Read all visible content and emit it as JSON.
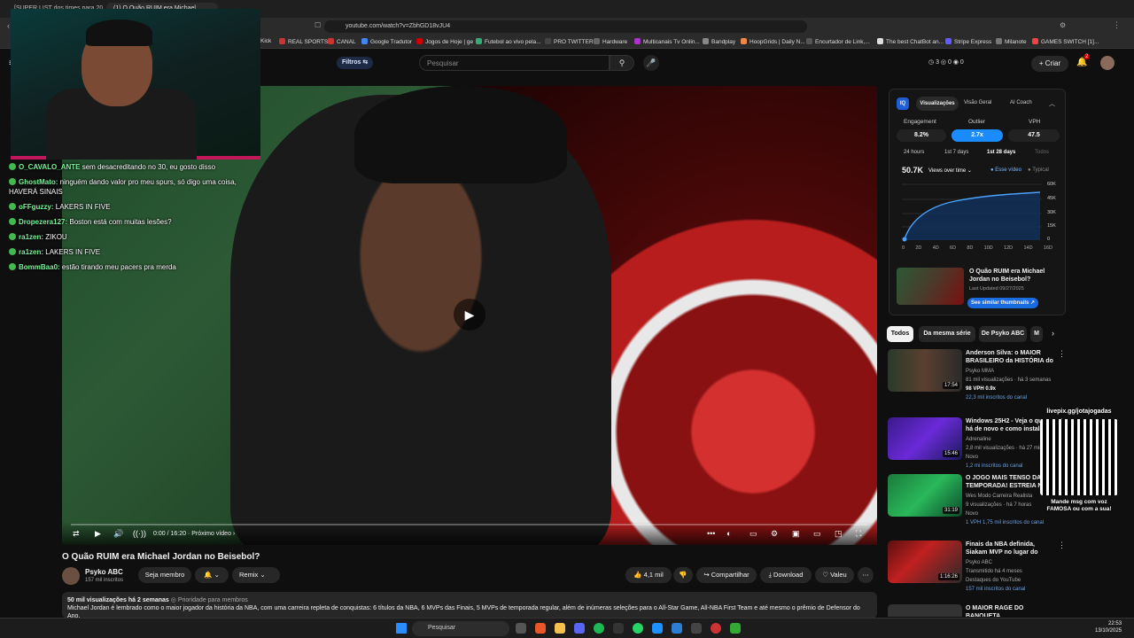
{
  "browser": {
    "tabs": [
      {
        "label": "[SUPER LIST dos times para 2026]",
        "active": false
      },
      {
        "label": "(1) O Quão RUIM era Michael",
        "active": true
      }
    ],
    "url": "youtube.com/watch?v=ZbhGD18vJU4",
    "bookmarks": [
      "Kick",
      "REAL SPORTS",
      "CANAL",
      "Google Tradutor",
      "Jogos de Hoje | ge",
      "Futebol ao vivo pela...",
      "PRO TWITTER",
      "Hardware",
      "Multicanais Tv Onlin...",
      "Bandplay",
      "HoopGrids | Daily N...",
      "Encurtador de Link,...",
      "The best ChatBot an...",
      "Stripe Express",
      "Milanote",
      "GAMES SWITCH [1]..."
    ]
  },
  "header": {
    "filters_label": "Filtros",
    "search_placeholder": "Pesquisar",
    "create_label": "Criar",
    "counters": [
      "3",
      "0",
      "0"
    ],
    "notifications": "2"
  },
  "stream": {
    "chat": [
      {
        "user": "O_CAVALO_ANTE",
        "text": "sem desacreditando no 30, eu gosto disso"
      },
      {
        "user": "GhostMato:",
        "text": "ninguém dando valor pro meu spurs, só digo uma coisa, HAVERÁ SINAIS"
      },
      {
        "user": "oFFguzzy:",
        "text": "LAKERS IN FIVE"
      },
      {
        "user": "Dropezera127:",
        "text": "Boston está com muitas lesões?"
      },
      {
        "user": "ra1zen:",
        "text": "ZIKOU"
      },
      {
        "user": "ra1zen:",
        "text": "LAKERS IN FIVE"
      },
      {
        "user": "BommBaa0:",
        "text": "estão tirando meu pacers pra merda"
      }
    ]
  },
  "player": {
    "time": "0:00 / 16:20",
    "next_label": "Próximo vídeo"
  },
  "video": {
    "title": "O Quão RUIM era Michael Jordan no Beisebol?",
    "channel": "Psyko ABC",
    "subscribers": "157 mil inscritos",
    "join_label": "Seja membro",
    "remix_label": "Remix",
    "likes": "4,1 mil",
    "share_label": "Compartilhar",
    "download_label": "Download",
    "thanks_label": "Valeu",
    "views_date": "50 mil visualizações  há 2 semanas",
    "priority": "Prioridade para membros",
    "description": "Michael Jordan é lembrado como o maior jogador da história da NBA, com uma carreira repleta de conquistas: 6 títulos da NBA, 6 MVPs das Finais, 5 MVPs de temporada regular, além de inúmeras seleções para o All-Star Game, All-NBA First Team e até mesmo o prêmio de Defensor do Ano."
  },
  "vidiq": {
    "tabs": [
      "Visualizações",
      "Visão Geral",
      "AI Coach"
    ],
    "metrics": [
      {
        "label": "Engagement",
        "value": "8.2%"
      },
      {
        "label": "Outlier",
        "value": "2.7x"
      },
      {
        "label": "VPH",
        "value": "47.5"
      }
    ],
    "periods": [
      "24 hours",
      "1st 7 days",
      "1st 28 days",
      "Todos"
    ],
    "total": "50.7K",
    "dropdown": "Views over time",
    "legend": [
      "Esse vídeo",
      "Typical"
    ],
    "y_ticks": [
      "60K",
      "45K",
      "30K",
      "15K",
      "0"
    ],
    "x_ticks": [
      "0",
      "2D",
      "4D",
      "6D",
      "8D",
      "10D",
      "12D",
      "14D",
      "16D"
    ],
    "thumb_title": "O Quão RUIM era Michael Jordan no Beisebol?",
    "last_updated": "Last Updated 09/27/2025",
    "similar_label": "See similar thumbnails"
  },
  "chips": [
    "Todos",
    "Da mesma série",
    "De Psyko ABC",
    "M"
  ],
  "recommendations": [
    {
      "title": "Anderson Silva: o MAIOR BRASILEIRO da HISTÓRIA do ...",
      "channel": "Psyko MMA",
      "meta": "81 mil visualizações · há 3 semanas",
      "stats": "98 VPH   0.9x",
      "subs": "22,3 mil inscritos do canal",
      "duration": "17:54"
    },
    {
      "title": "Windows 25H2 - Veja o que há de novo e como instalar",
      "channel": "Adrenaline",
      "meta": "2,8 mil visualizações · há 27 min",
      "stats": "Novo",
      "subs": "1,2 mi inscritos do canal",
      "duration": "15:46"
    },
    {
      "title": "O JOGO MAIS TENSO DA TEMPORADA! ESTREIA NA ...",
      "channel": "Wes Modo Carreira Realista",
      "meta": "9 visualizações · há 7 horas",
      "stats": "Novo",
      "subs": "1 VPH   1,75 mil inscritos do canal",
      "duration": "31:19"
    },
    {
      "title": "Finais da NBA definida, Siakam MVP no lugar do Haliburton, e ...",
      "channel": "Psyko ABC",
      "meta": "Transmitido há 4 meses",
      "stats": "Destaques do YouTube",
      "subs": "157 mil inscritos do canal",
      "duration": "1:16:26"
    },
    {
      "title": "O MAIOR RAGE DO BANQUETA",
      "channel": "",
      "meta": "",
      "stats": "",
      "subs": "",
      "duration": ""
    }
  ],
  "overlay_qr": {
    "url": "livepix.gg/jotajogadas",
    "caption": "Mande msg com voz FAMOSA ou com a sua!"
  },
  "taskbar": {
    "search": "Pesquisar",
    "time": "22:53",
    "date": "13/10/2025"
  }
}
